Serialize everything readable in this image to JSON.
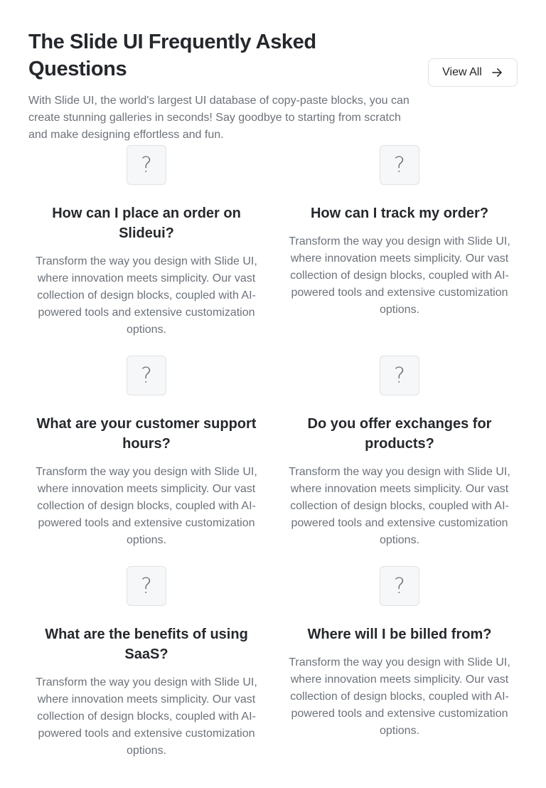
{
  "header": {
    "title": "The Slide UI Frequently Asked Questions",
    "subtitle": "With Slide UI, the world's largest UI database of copy-paste blocks, you can create stunning galleries in seconds! Say goodbye to starting from scratch and make designing effortless and fun.",
    "view_all_label": "View All"
  },
  "faq": [
    {
      "icon": "question-mark-icon",
      "glyph": "?",
      "question": "How can I place an order on Slideui?",
      "answer": "Transform the way you design with Slide UI, where innovation meets simplicity. Our vast collection of design blocks, coupled with AI-powered tools and extensive customization options."
    },
    {
      "icon": "question-mark-icon",
      "glyph": "?",
      "question": "How can I track my order?",
      "answer": "Transform the way you design with Slide UI, where innovation meets simplicity. Our vast collection of design blocks, coupled with AI-powered tools and extensive customization options."
    },
    {
      "icon": "question-mark-icon",
      "glyph": "?",
      "question": "What are your customer support hours?",
      "answer": "Transform the way you design with Slide UI, where innovation meets simplicity. Our vast collection of design blocks, coupled with AI-powered tools and extensive customization options."
    },
    {
      "icon": "question-mark-icon",
      "glyph": "?",
      "question": "Do you offer exchanges for products?",
      "answer": "Transform the way you design with Slide UI, where innovation meets simplicity. Our vast collection of design blocks, coupled with AI-powered tools and extensive customization options."
    },
    {
      "icon": "question-mark-icon",
      "glyph": "?",
      "question": "What are the benefits of using SaaS?",
      "answer": "Transform the way you design with Slide UI, where innovation meets simplicity. Our vast collection of design blocks, coupled with AI-powered tools and extensive customization options."
    },
    {
      "icon": "question-mark-icon",
      "glyph": "?",
      "question": "Where will I be billed from?",
      "answer": "Transform the way you design with Slide UI, where innovation meets simplicity. Our vast collection of design blocks, coupled with AI-powered tools and extensive customization options."
    }
  ],
  "colors": {
    "text_primary": "#25282c",
    "text_secondary": "#6c727a",
    "border": "#dfe2e6",
    "icon_box_bg": "#f6f7f8"
  }
}
